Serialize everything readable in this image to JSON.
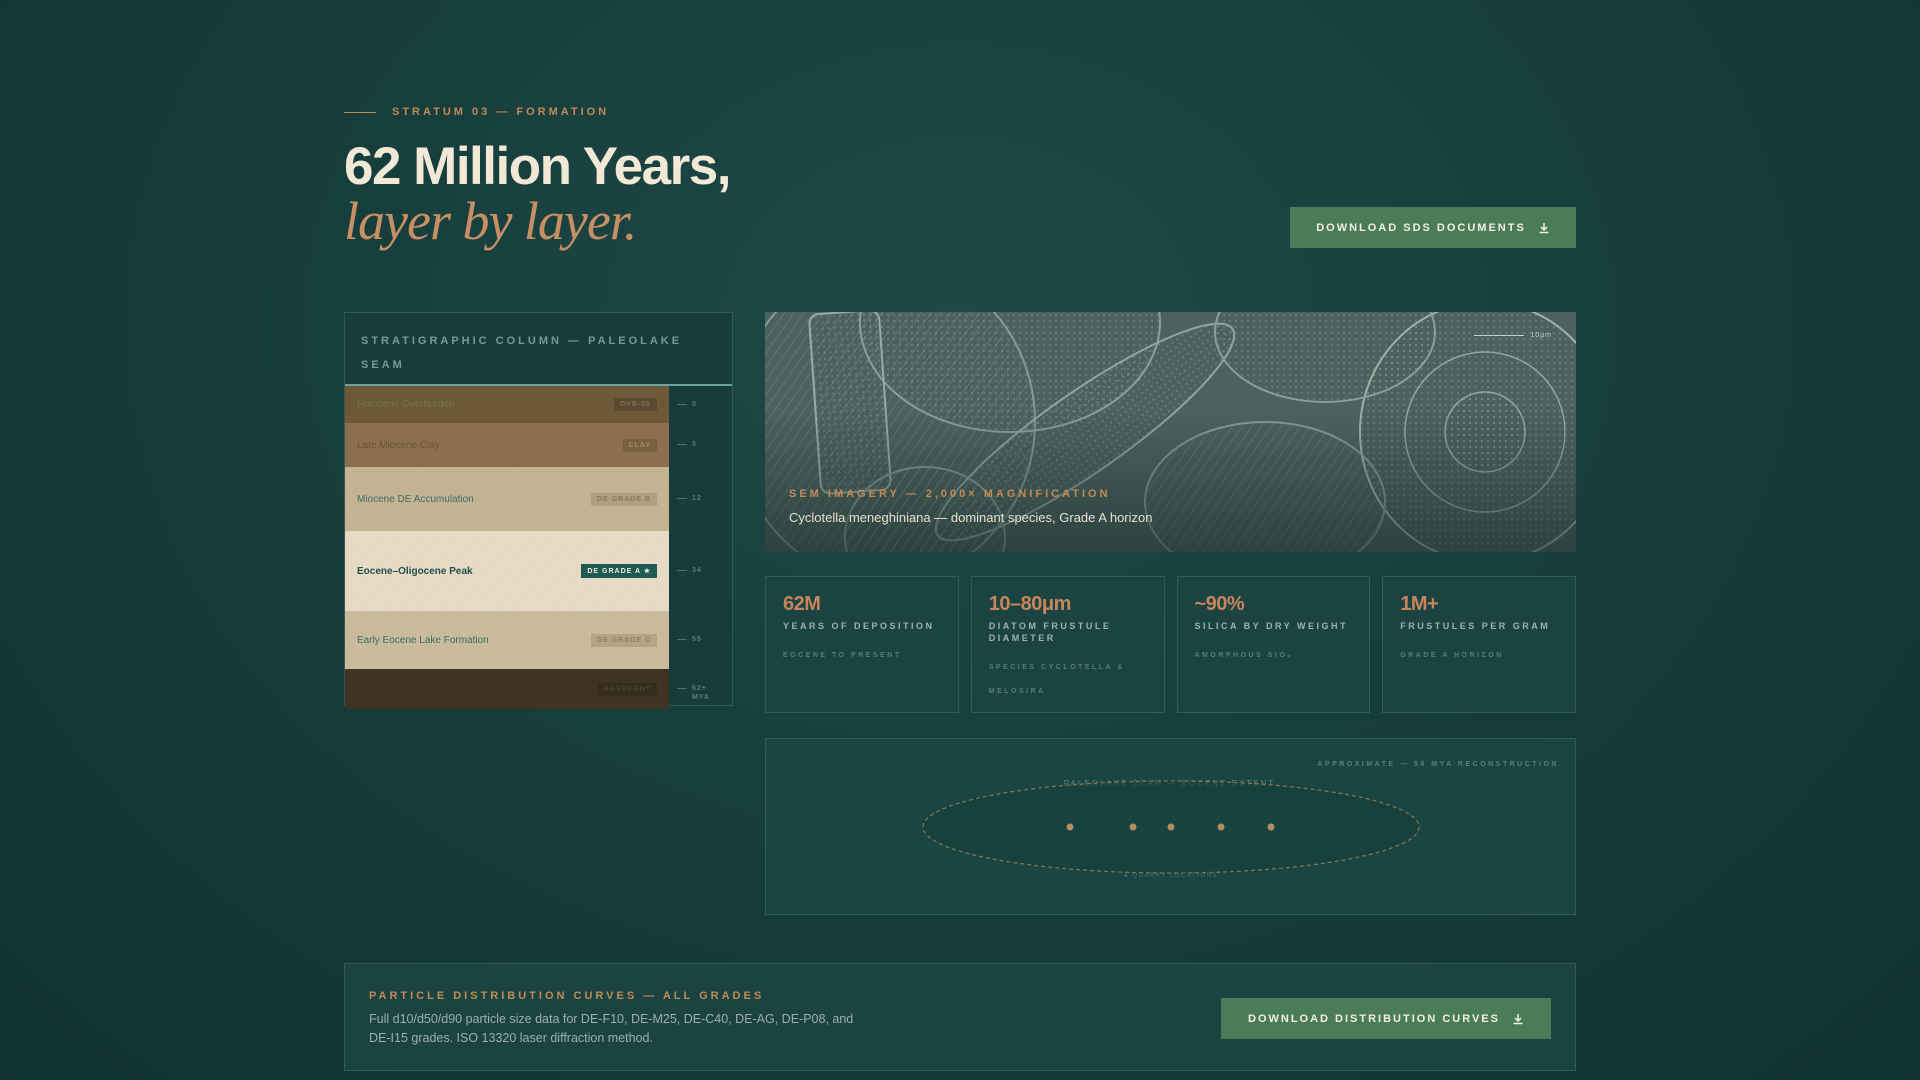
{
  "header": {
    "eyebrow": "STRATUM 03 — FORMATION",
    "title": "62 Million Years,",
    "subtitle": "layer by layer.",
    "sds_button": "DOWNLOAD SDS DOCUMENTS"
  },
  "strat": {
    "title": "STRATIGRAPHIC COLUMN — PALEOLAKE SEAM",
    "layers": [
      {
        "name": "Holocene Overburden",
        "tag": "OVB-00",
        "tick": "0",
        "bg": "#6e5837",
        "text_color": "#6c7a4e",
        "tag_bg": "#5b4a2f",
        "tag_color": "#807052"
      },
      {
        "name": "Late Miocene Clay",
        "tag": "CLAY",
        "tick": "5",
        "bg": "#8d6f4e",
        "text_color": "#6a5337",
        "tag_bg": "#7a5f41",
        "tag_color": "#a68b6a"
      },
      {
        "name": "Miocene DE Accumulation",
        "tag": "DE GRADE B",
        "tick": "12",
        "bg": "#c4b392",
        "text_color": "#3d6b63",
        "tag_bg": "#b0a07f",
        "tag_color": "#857a61"
      },
      {
        "name": "Eocene–Oligocene Peak",
        "tag": "DE GRADE A ★",
        "tick": "34",
        "bg": "#e6dac4",
        "text_color": "#1f4f4a",
        "tag_bg": "#1e5a54",
        "tag_color": "#f3ecdd"
      },
      {
        "name": "Early Eocene Lake Formation",
        "tag": "DE GRADE C",
        "tick": "55",
        "bg": "#c8ba9a",
        "text_color": "#3f6a61",
        "tag_bg": "#b4a585",
        "tag_color": "#8a7f64"
      },
      {
        "name": "Basement Rock",
        "tag": "BASEMENT",
        "tick": "62+ MYA",
        "bg": "#3f3423",
        "text_color": "#3d3627",
        "tag_bg": "#352c1e",
        "tag_color": "#4d4330"
      }
    ]
  },
  "sem": {
    "label": "SEM IMAGERY — 2,000× MAGNIFICATION",
    "caption": "Cyclotella meneghiniana — dominant species, Grade A horizon",
    "scale": "10μm"
  },
  "stats": [
    {
      "value": "62M",
      "label": "YEARS OF DEPOSITION",
      "note": "EOCENE TO PRESENT"
    },
    {
      "value": "10–80μm",
      "label": "DIATOM FRUSTULE DIAMETER",
      "note": "SPECIES CYCLOTELLA & MELOSIRA"
    },
    {
      "value": "~90%",
      "label": "SILICA BY DRY WEIGHT",
      "note": "AMORPHOUS SIO₂"
    },
    {
      "value": "1M+",
      "label": "FRUSTULES PER GRAM",
      "note": "GRADE A HORIZON"
    }
  ],
  "map": {
    "note": "APPROXIMATE — 56 MYA RECONSTRUCTION",
    "lake_label": "PALEOLAKE SEAM — EOCENE EXTENT",
    "bottom_label": "● QUARRY LOCATIONS"
  },
  "banner": {
    "title": "PARTICLE DISTRIBUTION CURVES — ALL GRADES",
    "text": "Full d10/d50/d90 particle size data for DE-F10, DE-M25, DE-C40, DE-AG, DE-P08, and DE-I15 grades. ISO 13320 laser diffraction method.",
    "button": "DOWNLOAD DISTRIBUTION CURVES"
  }
}
